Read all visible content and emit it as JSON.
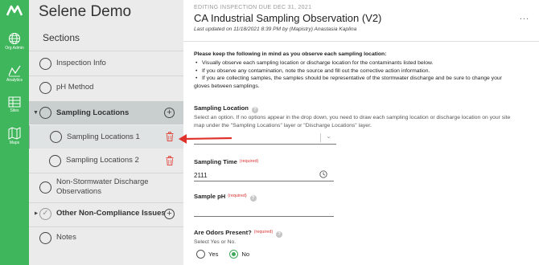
{
  "rail": {
    "items": [
      {
        "label": "Org Admin",
        "icon": "globe-icon"
      },
      {
        "label": "Analytics",
        "icon": "analytics-icon"
      },
      {
        "label": "Sites",
        "icon": "sites-icon"
      },
      {
        "label": "Maps",
        "icon": "map-icon"
      }
    ],
    "color": "#3fb65b"
  },
  "sections_panel": {
    "app_title": "Selene Demo",
    "heading": "Sections",
    "items": [
      {
        "label": "Inspection Info"
      },
      {
        "label": "pH Method"
      },
      {
        "label": "Sampling Locations"
      },
      {
        "label": "Sampling Locations 1"
      },
      {
        "label": "Sampling Locations 2"
      },
      {
        "label": "Non-Stormwater Discharge"
      },
      {
        "label": "Observations"
      },
      {
        "label": "Other Non-Compliance Issues"
      },
      {
        "label": "Notes"
      }
    ]
  },
  "header": {
    "due": "EDITING INSPECTION DUE DEC 31, 2021",
    "title": "CA Industrial Sampling Observation (V2)",
    "updated": "Last updated on 11/18/2021 8:39 PM by (Mapistry) Anastasia Kaplina",
    "more": "..."
  },
  "instructions": {
    "heading": "Please keep the following in mind as you observe each sampling location:",
    "bullets": [
      "Visually observe each sampling location or discharge location for the contaminants listed below.",
      "If you observe any contamination, note the source and fill out the corrective action information.",
      "If you are collecting samples, the samples should be representative of the stormwater discharge and be sure to change your",
      "gloves between samplings."
    ]
  },
  "fields": {
    "sampling_location": {
      "label": "Sampling Location",
      "hint1": "Select an option. If no options appear in the drop down, you need to draw each sampling location or discharge location on your site",
      "hint2": "map under the \"Sampling Locations\" layer or \"Discharge Locations\" layer."
    },
    "sampling_time": {
      "label": "Sampling Time",
      "required": "(required)",
      "value": "2111"
    },
    "sample_ph": {
      "label": "Sample pH",
      "required": "(required)",
      "value": ""
    },
    "odors": {
      "label": "Are Odors Present?",
      "required": "(required)",
      "hint": "Select Yes or No.",
      "options": [
        "Yes",
        "No"
      ],
      "selected": "No"
    }
  },
  "colors": {
    "accent": "#3fb65b",
    "trash": "#e0453e",
    "arrow": "#e0322c"
  }
}
